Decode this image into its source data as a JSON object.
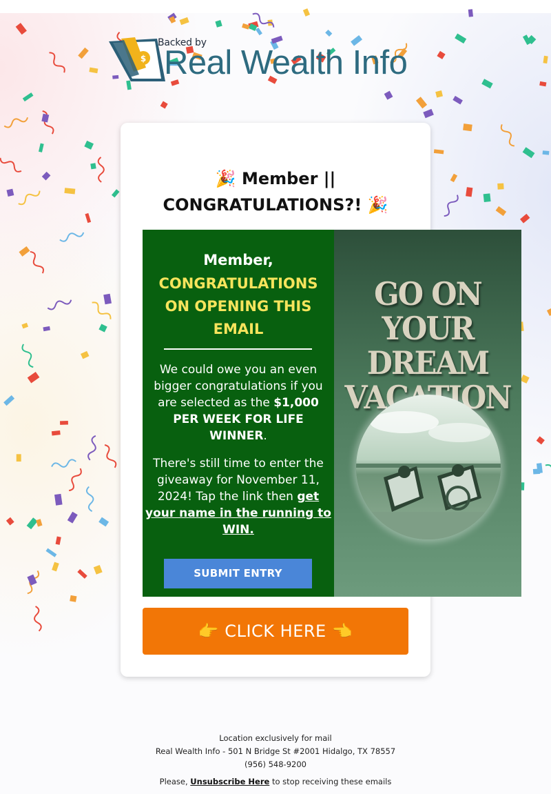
{
  "logo": {
    "tagline": "Backed by",
    "name": "Real Wealth Info"
  },
  "headline": {
    "line1": "🎉 Member ||",
    "line2": "CONGRATULATIONS?! 🎉"
  },
  "promo": {
    "greeting": "Member,",
    "congrats": "CONGRATULATIONS ON OPENING THIS EMAIL",
    "p1_text": "We could owe you an even bigger congratulations if you are selected as the ",
    "p1_bold": "$1,000 PER WEEK FOR LIFE WINNER",
    "p1_end": ".",
    "p2_text": "There's still time to enter the giveaway for November 11, 2024! Tap the link then ",
    "p2_link": "get your name in the running to WIN.",
    "submit_label": "SUBMIT ENTRY",
    "image_heading": "GO ON YOUR DREAM VACATION"
  },
  "cta": {
    "label": "👉 CLICK HERE 👈"
  },
  "footer": {
    "line1": "Location exclusively for mail",
    "address": "Real Wealth Info - 501 N Bridge St #2001 Hidalgo, TX 78557",
    "phone": "(956) 548-9200",
    "unsub_prefix": "Please, ",
    "unsub_link": "Unsubscribe Here",
    "unsub_suffix": " to stop receiving these emails"
  },
  "colors": {
    "promo_green": "#08600f",
    "congrats_yellow": "#f6e45c",
    "submit_blue": "#4a86d8",
    "cta_orange": "#f27606",
    "brand_teal": "#2e6b80"
  }
}
